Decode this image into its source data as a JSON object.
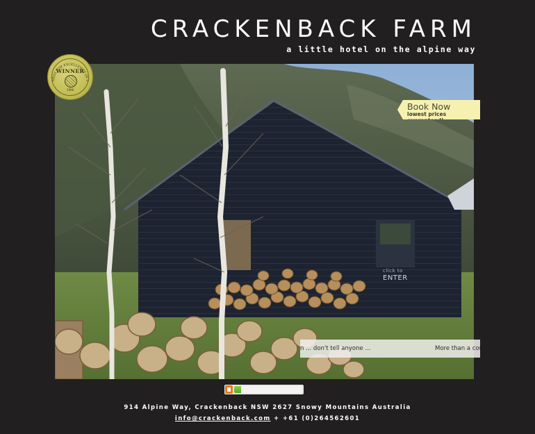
{
  "header": {
    "title": "CRACKENBACK FARM",
    "tagline": "a little hotel on the alpine way"
  },
  "award_badge": {
    "winner_label": "WINNER",
    "arc_text": "NSW AWARDS FOR EXCELLENCE IN TOURISM",
    "year": "1998",
    "color": "#c2bd54"
  },
  "book_now": {
    "label": "Book Now",
    "sublabel": "lowest prices guaranteed!",
    "background": "#f6f1b0"
  },
  "enter": {
    "hint": "click to",
    "label": "ENTER"
  },
  "ticker": {
    "text_1": "n ... don't tell anyone ...",
    "text_2": "More than a cou"
  },
  "slideshow": {
    "stop_icon": "stop-icon",
    "progress_fraction": 0.1,
    "accent": "#e87a1c",
    "progress_color": "#5aa72a"
  },
  "footer": {
    "address": "914 Alpine Way, Crackenback NSW 2627 Snowy Mountains Australia",
    "email": "info@crackenback.com",
    "separator": "+",
    "phone": "+61 (0)264562601"
  }
}
